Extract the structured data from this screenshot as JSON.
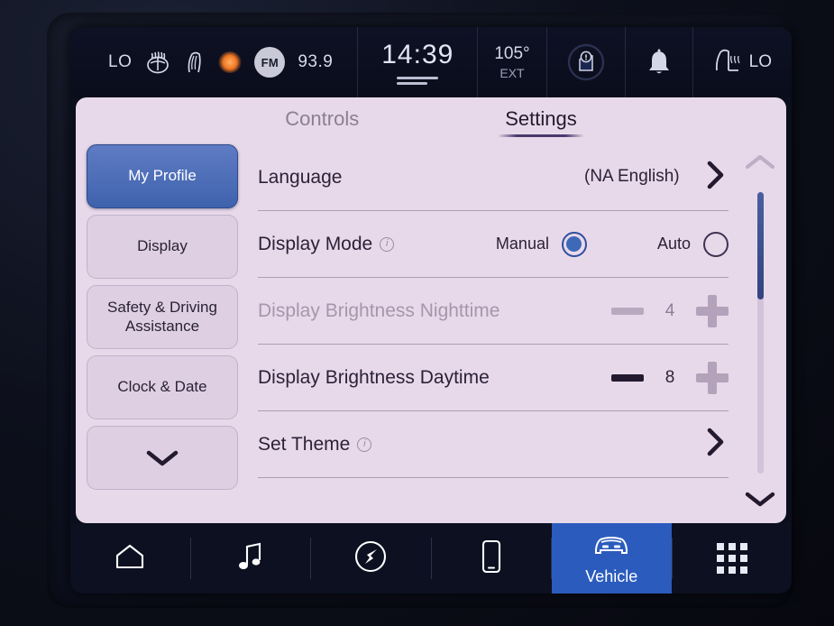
{
  "statusbar": {
    "climate_left_label": "LO",
    "defrost_icon": "rear-defrost-icon",
    "fan_icon": "fan-icon",
    "seat_heat_glow_icon": "heated-seat-glow-icon",
    "radio_band": "FM",
    "radio_frequency": "93.9",
    "clock": "14:39",
    "ext_temp": "105°",
    "ext_label": "EXT",
    "warning_icon": "door-ajar-warning-icon",
    "notification_icon": "bell-icon",
    "seat_icon": "heated-seat-icon",
    "climate_right_label": "LO"
  },
  "tabs": {
    "controls": "Controls",
    "settings": "Settings",
    "active": "Settings"
  },
  "sidebar": {
    "items": [
      {
        "label": "My Profile",
        "selected": true
      },
      {
        "label": "Display",
        "selected": false
      },
      {
        "label": "Safety & Driving Assistance",
        "selected": false
      },
      {
        "label": "Clock & Date",
        "selected": false
      }
    ],
    "more_icon": "chevron-down-icon"
  },
  "settings_rows": [
    {
      "label": "Language",
      "type": "navigate",
      "value": "(NA English)",
      "chevron": "chevron-right-icon",
      "disabled": false,
      "info": false
    },
    {
      "label": "Display Mode",
      "type": "radio",
      "info": true,
      "disabled": false,
      "options": [
        {
          "label": "Manual",
          "selected": true
        },
        {
          "label": "Auto",
          "selected": false
        }
      ]
    },
    {
      "label": "Display Brightness Nighttime",
      "type": "stepper",
      "value": "4",
      "disabled": true,
      "info": false,
      "minus_icon": "minus-icon",
      "plus_icon": "plus-icon"
    },
    {
      "label": "Display Brightness Daytime",
      "type": "stepper",
      "value": "8",
      "disabled": false,
      "info": false,
      "minus_icon": "minus-icon",
      "plus_icon": "plus-icon"
    },
    {
      "label": "Set Theme",
      "type": "navigate",
      "value": "",
      "chevron": "chevron-right-icon",
      "disabled": false,
      "info": true
    }
  ],
  "scrollbar": {
    "up_icon": "chevron-up-icon",
    "down_icon": "chevron-down-icon",
    "thumb_position": "top"
  },
  "navbar": {
    "items": [
      {
        "label": "",
        "icon": "home-icon",
        "selected": false
      },
      {
        "label": "",
        "icon": "music-note-icon",
        "selected": false
      },
      {
        "label": "",
        "icon": "navigation-icon",
        "selected": false
      },
      {
        "label": "",
        "icon": "phone-icon",
        "selected": false
      },
      {
        "label": "Vehicle",
        "icon": "car-icon",
        "selected": true
      },
      {
        "label": "",
        "icon": "apps-grid-icon",
        "selected": false
      }
    ]
  },
  "colors": {
    "panel_bg": "#e8d9ea",
    "accent_blue": "#3f62ad",
    "nav_selected_blue": "#2b5bbd",
    "text_dark": "#2c2238",
    "text_disabled": "#a696ac",
    "statusbar_bg": "#0a0d1b"
  }
}
